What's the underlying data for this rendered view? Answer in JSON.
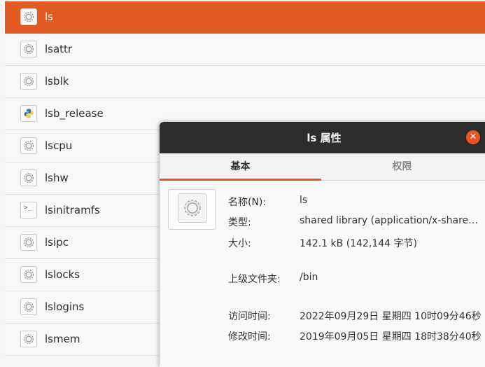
{
  "files": [
    {
      "name": "ls",
      "icon": "executable-gear-icon",
      "selected": true
    },
    {
      "name": "lsattr",
      "icon": "executable-gear-icon"
    },
    {
      "name": "lsblk",
      "icon": "executable-gear-icon"
    },
    {
      "name": "lsb_release",
      "icon": "python-script-icon"
    },
    {
      "name": "lscpu",
      "icon": "executable-gear-icon"
    },
    {
      "name": "lshw",
      "icon": "executable-gear-icon"
    },
    {
      "name": "lsinitramfs",
      "icon": "terminal-script-icon"
    },
    {
      "name": "lsipc",
      "icon": "executable-gear-icon"
    },
    {
      "name": "lslocks",
      "icon": "executable-gear-icon"
    },
    {
      "name": "lslogins",
      "icon": "executable-gear-icon"
    },
    {
      "name": "lsmem",
      "icon": "executable-gear-icon"
    }
  ],
  "dialog": {
    "title": "ls 属性",
    "close_icon": "close-icon",
    "tabs": {
      "basic": "基本",
      "permissions": "权限"
    },
    "props": {
      "name_label": "名称(N):",
      "name_value": "ls",
      "type_label": "类型:",
      "type_value": "shared library (application/x-share…",
      "size_label": "大小:",
      "size_value": "142.1 kB (142,144 字节)",
      "parent_label": "上级文件夹:",
      "parent_value": "/bin",
      "accessed_label": "访问时间:",
      "accessed_value": "2022年09月29日 星期四 10时09分46秒",
      "modified_label": "修改时间:",
      "modified_value": "2019年09月05日 星期四 18时38分40秒"
    }
  },
  "colors": {
    "accent": "#e95420",
    "selection": "#e05a22",
    "titlebar": "#2c2c2c"
  }
}
